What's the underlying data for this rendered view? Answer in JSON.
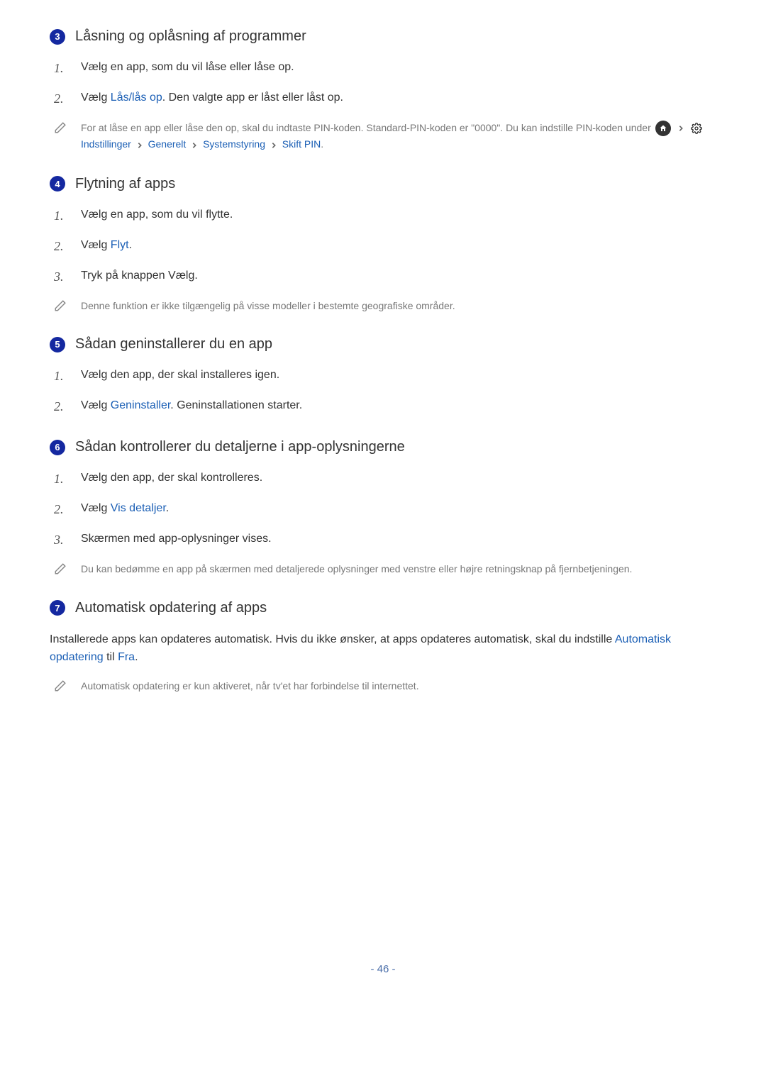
{
  "section3": {
    "num": "3",
    "title": "Låsning og oplåsning af programmer",
    "step1": {
      "n": "1.",
      "text": "Vælg en app, som du vil låse eller låse op."
    },
    "step2": {
      "n": "2.",
      "pre": "Vælg ",
      "link": "Lås/lås op",
      "post": ". Den valgte app er låst eller låst op."
    },
    "note": {
      "pre": "For at låse en app eller låse den op, skal du indtaste PIN-koden. Standard-PIN-koden er \"0000\". Du kan indstille PIN-koden under ",
      "path": {
        "p1": "Indstillinger",
        "p2": "Generelt",
        "p3": "Systemstyring",
        "p4": "Skift PIN"
      },
      "post": "."
    }
  },
  "section4": {
    "num": "4",
    "title": "Flytning af apps",
    "step1": {
      "n": "1.",
      "text": "Vælg en app, som du vil flytte."
    },
    "step2": {
      "n": "2.",
      "pre": "Vælg ",
      "link": "Flyt",
      "post": "."
    },
    "step3": {
      "n": "3.",
      "text": "Tryk på knappen Vælg."
    },
    "note": "Denne funktion er ikke tilgængelig på visse modeller i bestemte geografiske områder."
  },
  "section5": {
    "num": "5",
    "title": "Sådan geninstallerer du en app",
    "step1": {
      "n": "1.",
      "text": "Vælg den app, der skal installeres igen."
    },
    "step2": {
      "n": "2.",
      "pre": "Vælg ",
      "link": "Geninstaller",
      "post": ". Geninstallationen starter."
    }
  },
  "section6": {
    "num": "6",
    "title": "Sådan kontrollerer du detaljerne i app-oplysningerne",
    "step1": {
      "n": "1.",
      "text": "Vælg den app, der skal kontrolleres."
    },
    "step2": {
      "n": "2.",
      "pre": "Vælg ",
      "link": "Vis detaljer",
      "post": "."
    },
    "step3": {
      "n": "3.",
      "text": "Skærmen med app-oplysninger vises."
    },
    "note": "Du kan bedømme en app på skærmen med detaljerede oplysninger med venstre eller højre retningsknap på fjernbetjeningen."
  },
  "section7": {
    "num": "7",
    "title": "Automatisk opdatering af apps",
    "para": {
      "pre": "Installerede apps kan opdateres automatisk. Hvis du ikke ønsker, at apps opdateres automatisk, skal du indstille ",
      "link1": "Automatisk opdatering",
      "mid": " til ",
      "link2": "Fra",
      "post": "."
    },
    "note": "Automatisk opdatering er kun aktiveret, når tv'et har forbindelse til internettet."
  },
  "pageNumber": "- 46 -"
}
